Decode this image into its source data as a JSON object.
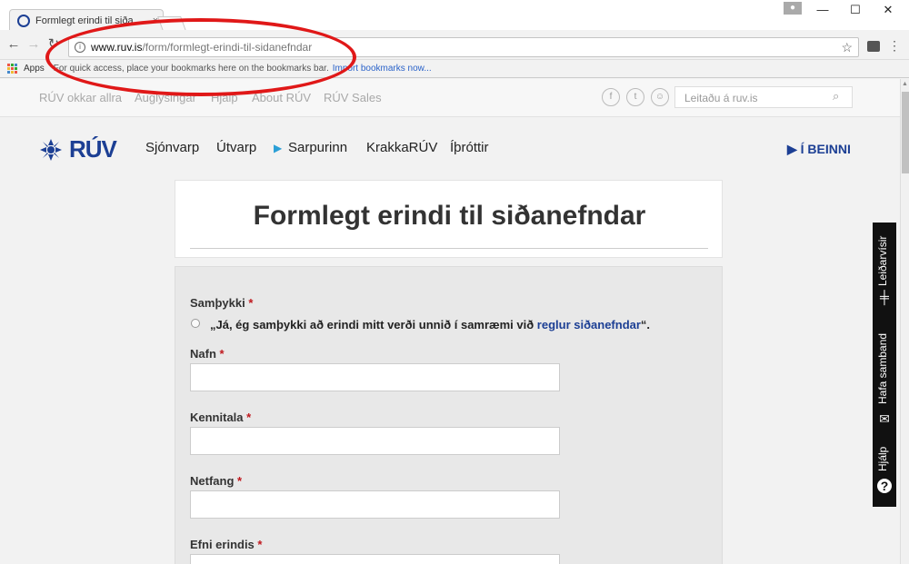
{
  "browser": {
    "tab_title": "Formlegt erindi til siða...",
    "tab_close": "×",
    "window_minimize": "—",
    "window_maximize": "☐",
    "window_close": "✕",
    "url_host": "www.ruv.is",
    "url_path": "/form/formlegt-erindi-til-sidanefndar",
    "bookmarks_apps": "Apps",
    "bookmarks_hint": "For quick access, place your bookmarks here on the bookmarks bar.",
    "bookmarks_import": "Import bookmarks now..."
  },
  "topnav": {
    "links": [
      "RÚV okkar allra",
      "Auglýsingar",
      "Hjálp",
      "About RÚV",
      "RÚV Sales"
    ],
    "search_placeholder": "Leitaðu á ruv.is"
  },
  "mainnav": {
    "logo": "RÚV",
    "links": [
      "Sjónvarp",
      "Útvarp",
      "Sarpurinn",
      "KrakkaRÚV",
      "Íþróttir"
    ],
    "live": "▶ Í BEINNI"
  },
  "form": {
    "title": "Formlegt erindi til siðanefndar",
    "consent_label": "Samþykki",
    "required_mark": "*",
    "consent_text_pre": "„Já, ég samþykki að erindi mitt verði unnið í samræmi við ",
    "consent_link": "reglur siðanefndar",
    "consent_text_post": "“.",
    "fields": [
      "Nafn",
      "Kennitala",
      "Netfang",
      "Efni erindis"
    ]
  },
  "sidebar": {
    "items": [
      "Leiðarvísir",
      "Hafa samband",
      "Hjálp"
    ]
  },
  "colors": {
    "brand": "#1c3f94",
    "required": "#c0181e",
    "annotation": "#e01818"
  }
}
